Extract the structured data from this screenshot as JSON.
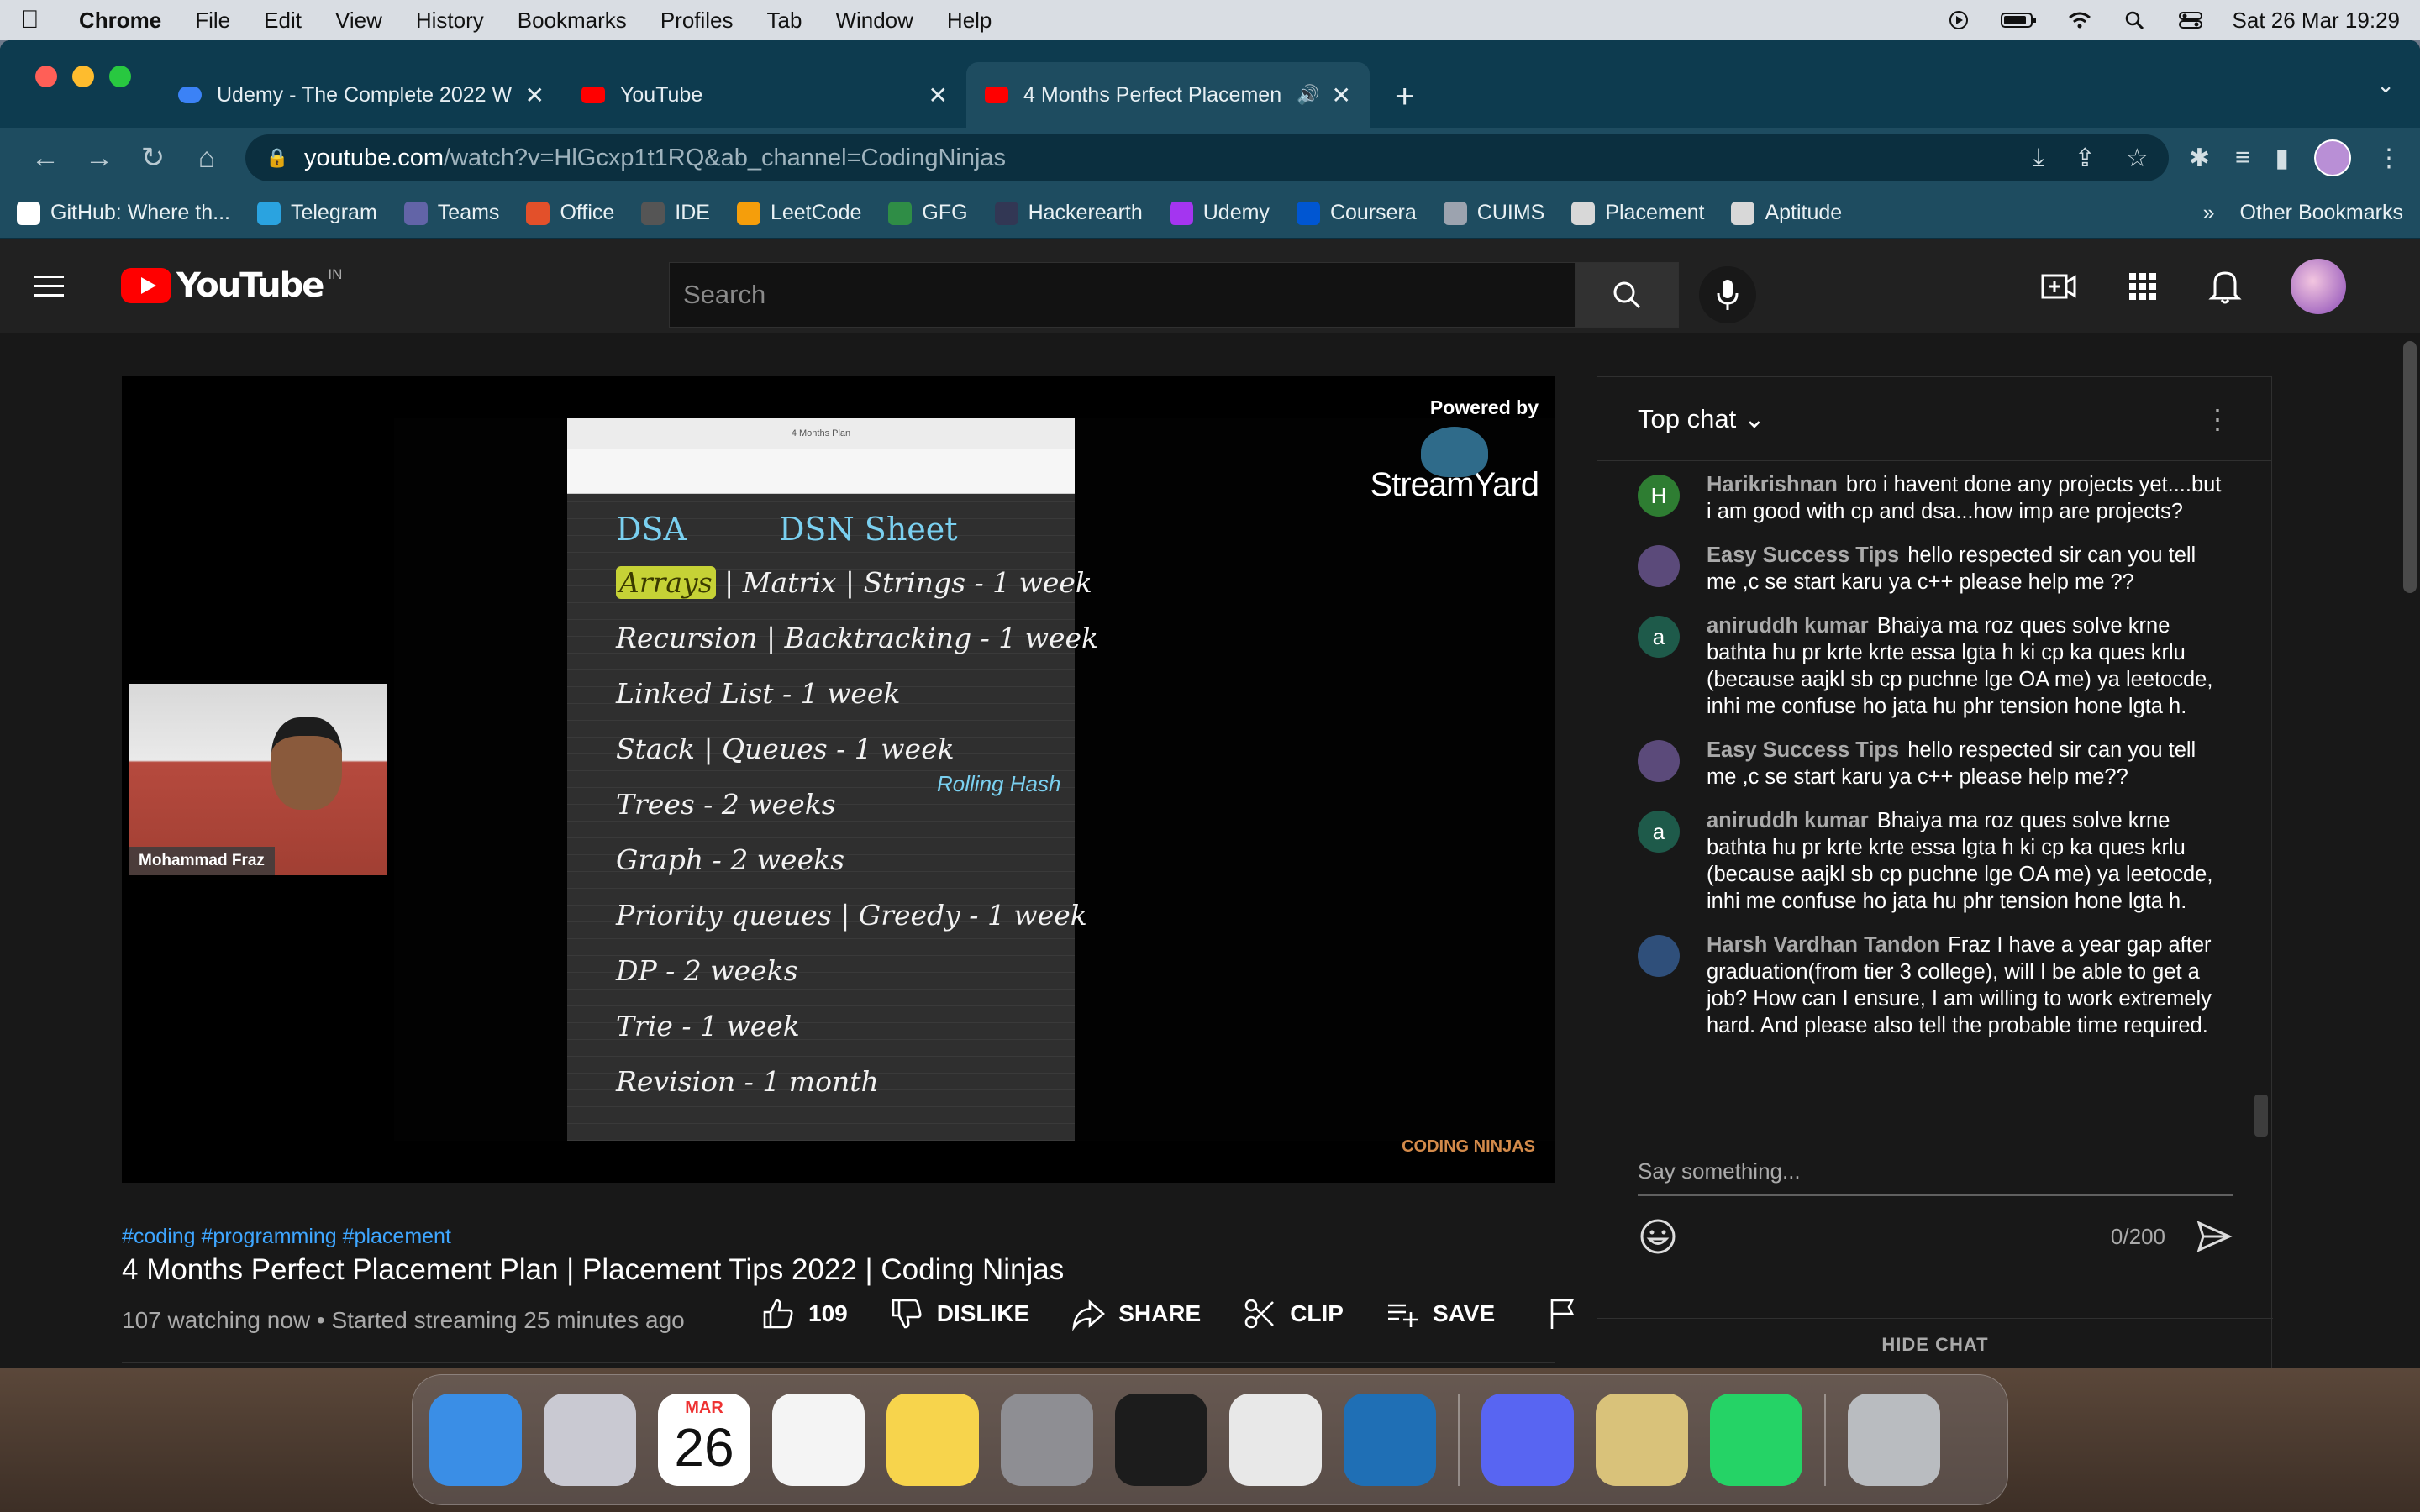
{
  "menubar": {
    "app": "Chrome",
    "items": [
      "File",
      "Edit",
      "View",
      "History",
      "Bookmarks",
      "Profiles",
      "Tab",
      "Window",
      "Help"
    ],
    "datetime": "Sat 26 Mar  19:29"
  },
  "tabs": [
    {
      "title": "Udemy - The Complete 2022 W",
      "favicon_color": "#3b82f6"
    },
    {
      "title": "YouTube",
      "favicon_color": "#ff0000"
    },
    {
      "title": "4 Months Perfect Placemen",
      "favicon_color": "#ff0000"
    }
  ],
  "omnibox": {
    "host": "youtube.com",
    "path": "/watch?v=HlGcxp1t1RQ&ab_channel=CodingNinjas"
  },
  "bookmarks": [
    {
      "label": "GitHub: Where th...",
      "color": "#ffffff"
    },
    {
      "label": "Telegram",
      "color": "#2aa3e0"
    },
    {
      "label": "Teams",
      "color": "#6264a7"
    },
    {
      "label": "Office",
      "color": "#e3502a"
    },
    {
      "label": "IDE",
      "color": "#555555"
    },
    {
      "label": "LeetCode",
      "color": "#f59e0b"
    },
    {
      "label": "GFG",
      "color": "#2f8d46"
    },
    {
      "label": "Hackerearth",
      "color": "#323754"
    },
    {
      "label": "Udemy",
      "color": "#a435f0"
    },
    {
      "label": "Coursera",
      "color": "#0056d2"
    },
    {
      "label": "CUIMS",
      "color": "#9ca3af"
    },
    {
      "label": "Placement",
      "color": "#d8d8d8"
    },
    {
      "label": "Aptitude",
      "color": "#d8d8d8"
    }
  ],
  "bookmarks_more": "»",
  "bookmarks_other": "Other Bookmarks",
  "youtube": {
    "logo": "YouTube",
    "country": "IN",
    "search_placeholder": "Search"
  },
  "video": {
    "overlay": {
      "powered_by": "Powered by",
      "brand": "StreamYard",
      "cam_name": "Mohammad Fraz",
      "corner_logo": "CODING NINJAS"
    },
    "notes": {
      "heading_left": "DSA",
      "heading_right": "DSN Sheet",
      "highlight": "Arrays",
      "line1_rest": " | Matrix | Strings - 1 week",
      "lines": [
        "Recursion | Backtracking - 1 week",
        "Linked List - 1 week",
        "Stack | Queues - 1 week",
        "Trees - 2 weeks",
        "Graph - 2 weeks",
        "Priority queues | Greedy - 1 week",
        "DP - 2 weeks",
        "Trie - 1 week",
        "Revision - 1 month"
      ],
      "side_note": "Rolling Hash"
    },
    "hashtags": "#coding #programming #placement",
    "title": "4 Months Perfect Placement Plan | Placement Tips 2022 | Coding Ninjas",
    "meta": "107 watching now • Started streaming 25 minutes ago",
    "likes": "109",
    "dislike_label": "DISLIKE",
    "share_label": "SHARE",
    "clip_label": "CLIP",
    "save_label": "SAVE"
  },
  "chat": {
    "mode": "Top chat",
    "messages": [
      {
        "initial": "H",
        "avatar_color": "#2e7d32",
        "author": "Harikrishnan",
        "text": "bro i havent done any projects yet....but i am good with cp and dsa...how imp are projects?"
      },
      {
        "initial": "",
        "avatar_color": "#5b4a7a",
        "author": "Easy Success Tips",
        "text": "hello respected sir can you tell me ,c se start karu ya c++ please help me ??"
      },
      {
        "initial": "a",
        "avatar_color": "#1e5a4a",
        "author": "aniruddh kumar",
        "text": "Bhaiya ma roz ques solve krne bathta hu pr krte krte essa lgta h ki cp ka ques krlu (because aajkl sb cp puchne lge OA me) ya leetocde, inhi me confuse ho jata hu phr tension hone lgta h."
      },
      {
        "initial": "",
        "avatar_color": "#5b4a7a",
        "author": "Easy Success Tips",
        "text": "hello respected sir can you tell me ,c se start karu ya c++ please help me??"
      },
      {
        "initial": "a",
        "avatar_color": "#1e5a4a",
        "author": "aniruddh kumar",
        "text": "Bhaiya ma roz ques solve krne bathta hu pr krte krte essa lgta h ki cp ka ques krlu (because aajkl sb cp puchne lge OA me) ya leetocde, inhi me confuse ho jata hu phr tension hone lgta h."
      },
      {
        "initial": "",
        "avatar_color": "#2f4f7a",
        "author": "Harsh Vardhan Tandon",
        "text": "Fraz I have a year gap after graduation(from tier 3 college), will I be able to get a job? How can I ensure, I am willing to work extremely hard. And please also tell the probable time required."
      }
    ],
    "input_placeholder": "Say something...",
    "counter": "0/200",
    "hide_label": "HIDE CHAT"
  },
  "dock": {
    "calendar_month": "MAR",
    "calendar_day": "26",
    "apps": [
      {
        "name": "finder",
        "color": "#3a8ee6"
      },
      {
        "name": "launchpad",
        "color": "#c9c9d2"
      },
      {
        "name": "calendar",
        "color": "#ffffff"
      },
      {
        "name": "reminders",
        "color": "#f4f4f4"
      },
      {
        "name": "notes",
        "color": "#f7d44c"
      },
      {
        "name": "system-preferences",
        "color": "#8e8e93"
      },
      {
        "name": "terminal",
        "color": "#1c1c1c"
      },
      {
        "name": "chrome",
        "color": "#e8e8e8"
      },
      {
        "name": "vscode",
        "color": "#1f6fb5"
      },
      {
        "name": "discord",
        "color": "#5865f2"
      },
      {
        "name": "mail-app",
        "color": "#d9c27a"
      },
      {
        "name": "whatsapp",
        "color": "#25d366"
      },
      {
        "name": "trash",
        "color": "#b9bcc0"
      }
    ]
  }
}
